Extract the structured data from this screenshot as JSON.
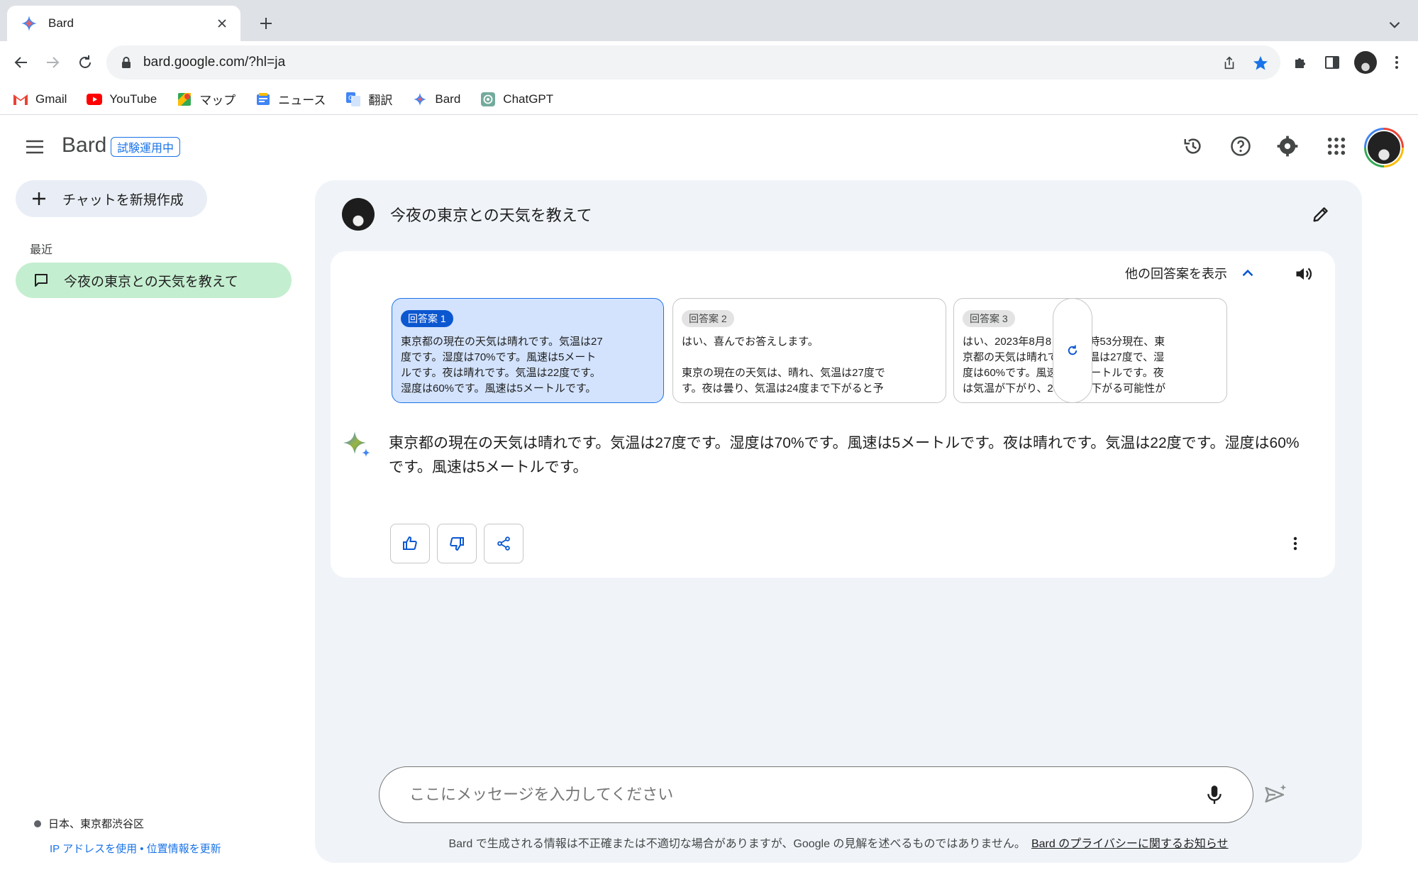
{
  "browser": {
    "tab_title": "Bard",
    "url": "bard.google.com/?hl=ja",
    "bookmarks": [
      {
        "label": "Gmail",
        "icon": "gmail-icon"
      },
      {
        "label": "YouTube",
        "icon": "youtube-icon"
      },
      {
        "label": "マップ",
        "icon": "maps-icon"
      },
      {
        "label": "ニュース",
        "icon": "news-icon"
      },
      {
        "label": "翻訳",
        "icon": "translate-icon"
      },
      {
        "label": "Bard",
        "icon": "bard-icon"
      },
      {
        "label": "ChatGPT",
        "icon": "chatgpt-icon"
      }
    ]
  },
  "header": {
    "brand": "Bard",
    "badge": "試験運用中"
  },
  "sidebar": {
    "new_chat": "チャットを新規作成",
    "recent_label": "最近",
    "recent_items": [
      {
        "label": "今夜の東京との天気を教えて"
      }
    ],
    "location": "日本、東京都渋谷区",
    "location_link": "IP アドレスを使用 • 位置情報を更新"
  },
  "conversation": {
    "prompt": "今夜の東京との天気を教えて",
    "show_drafts": "他の回答案を表示",
    "drafts": [
      {
        "label": "回答案 1",
        "text": "東京都の現在の天気は晴れです。気温は27\n度です。湿度は70%です。風速は5メート\nルです。夜は晴れです。気温は22度です。\n湿度は60%です。風速は5メートルです。"
      },
      {
        "label": "回答案 2",
        "text": "はい、喜んでお答えします。\n\n東京の現在の天気は、晴れ、気温は27度で\nす。夜は曇り、気温は24度まで下がると予"
      },
      {
        "label": "回答案 3",
        "text": "はい、2023年8月8日午後7時53分現在、東\n京都の天気は晴れです。気温は27度で、湿\n度は60%です。風速は10メートルです。夜\nは気温が下がり、23度まで下がる可能性が"
      }
    ],
    "answer": "東京都の現在の天気は晴れです。気温は27度です。湿度は70%です。風速は5メートルです。夜は晴れです。気温は22度です。湿度は60%です。風速は5メートルです。"
  },
  "input": {
    "placeholder": "ここにメッセージを入力してください"
  },
  "footer": {
    "disclaimer": "Bard で生成される情報は不正確または不適切な場合がありますが、Google の見解を述べるものではありません。",
    "privacy_link": "Bard のプライバシーに関するお知らせ"
  },
  "colors": {
    "accent": "#1a73e8",
    "active_chat": "#c4eed0",
    "panel_bg": "#f0f4f9",
    "active_draft": "#d3e3fd"
  }
}
